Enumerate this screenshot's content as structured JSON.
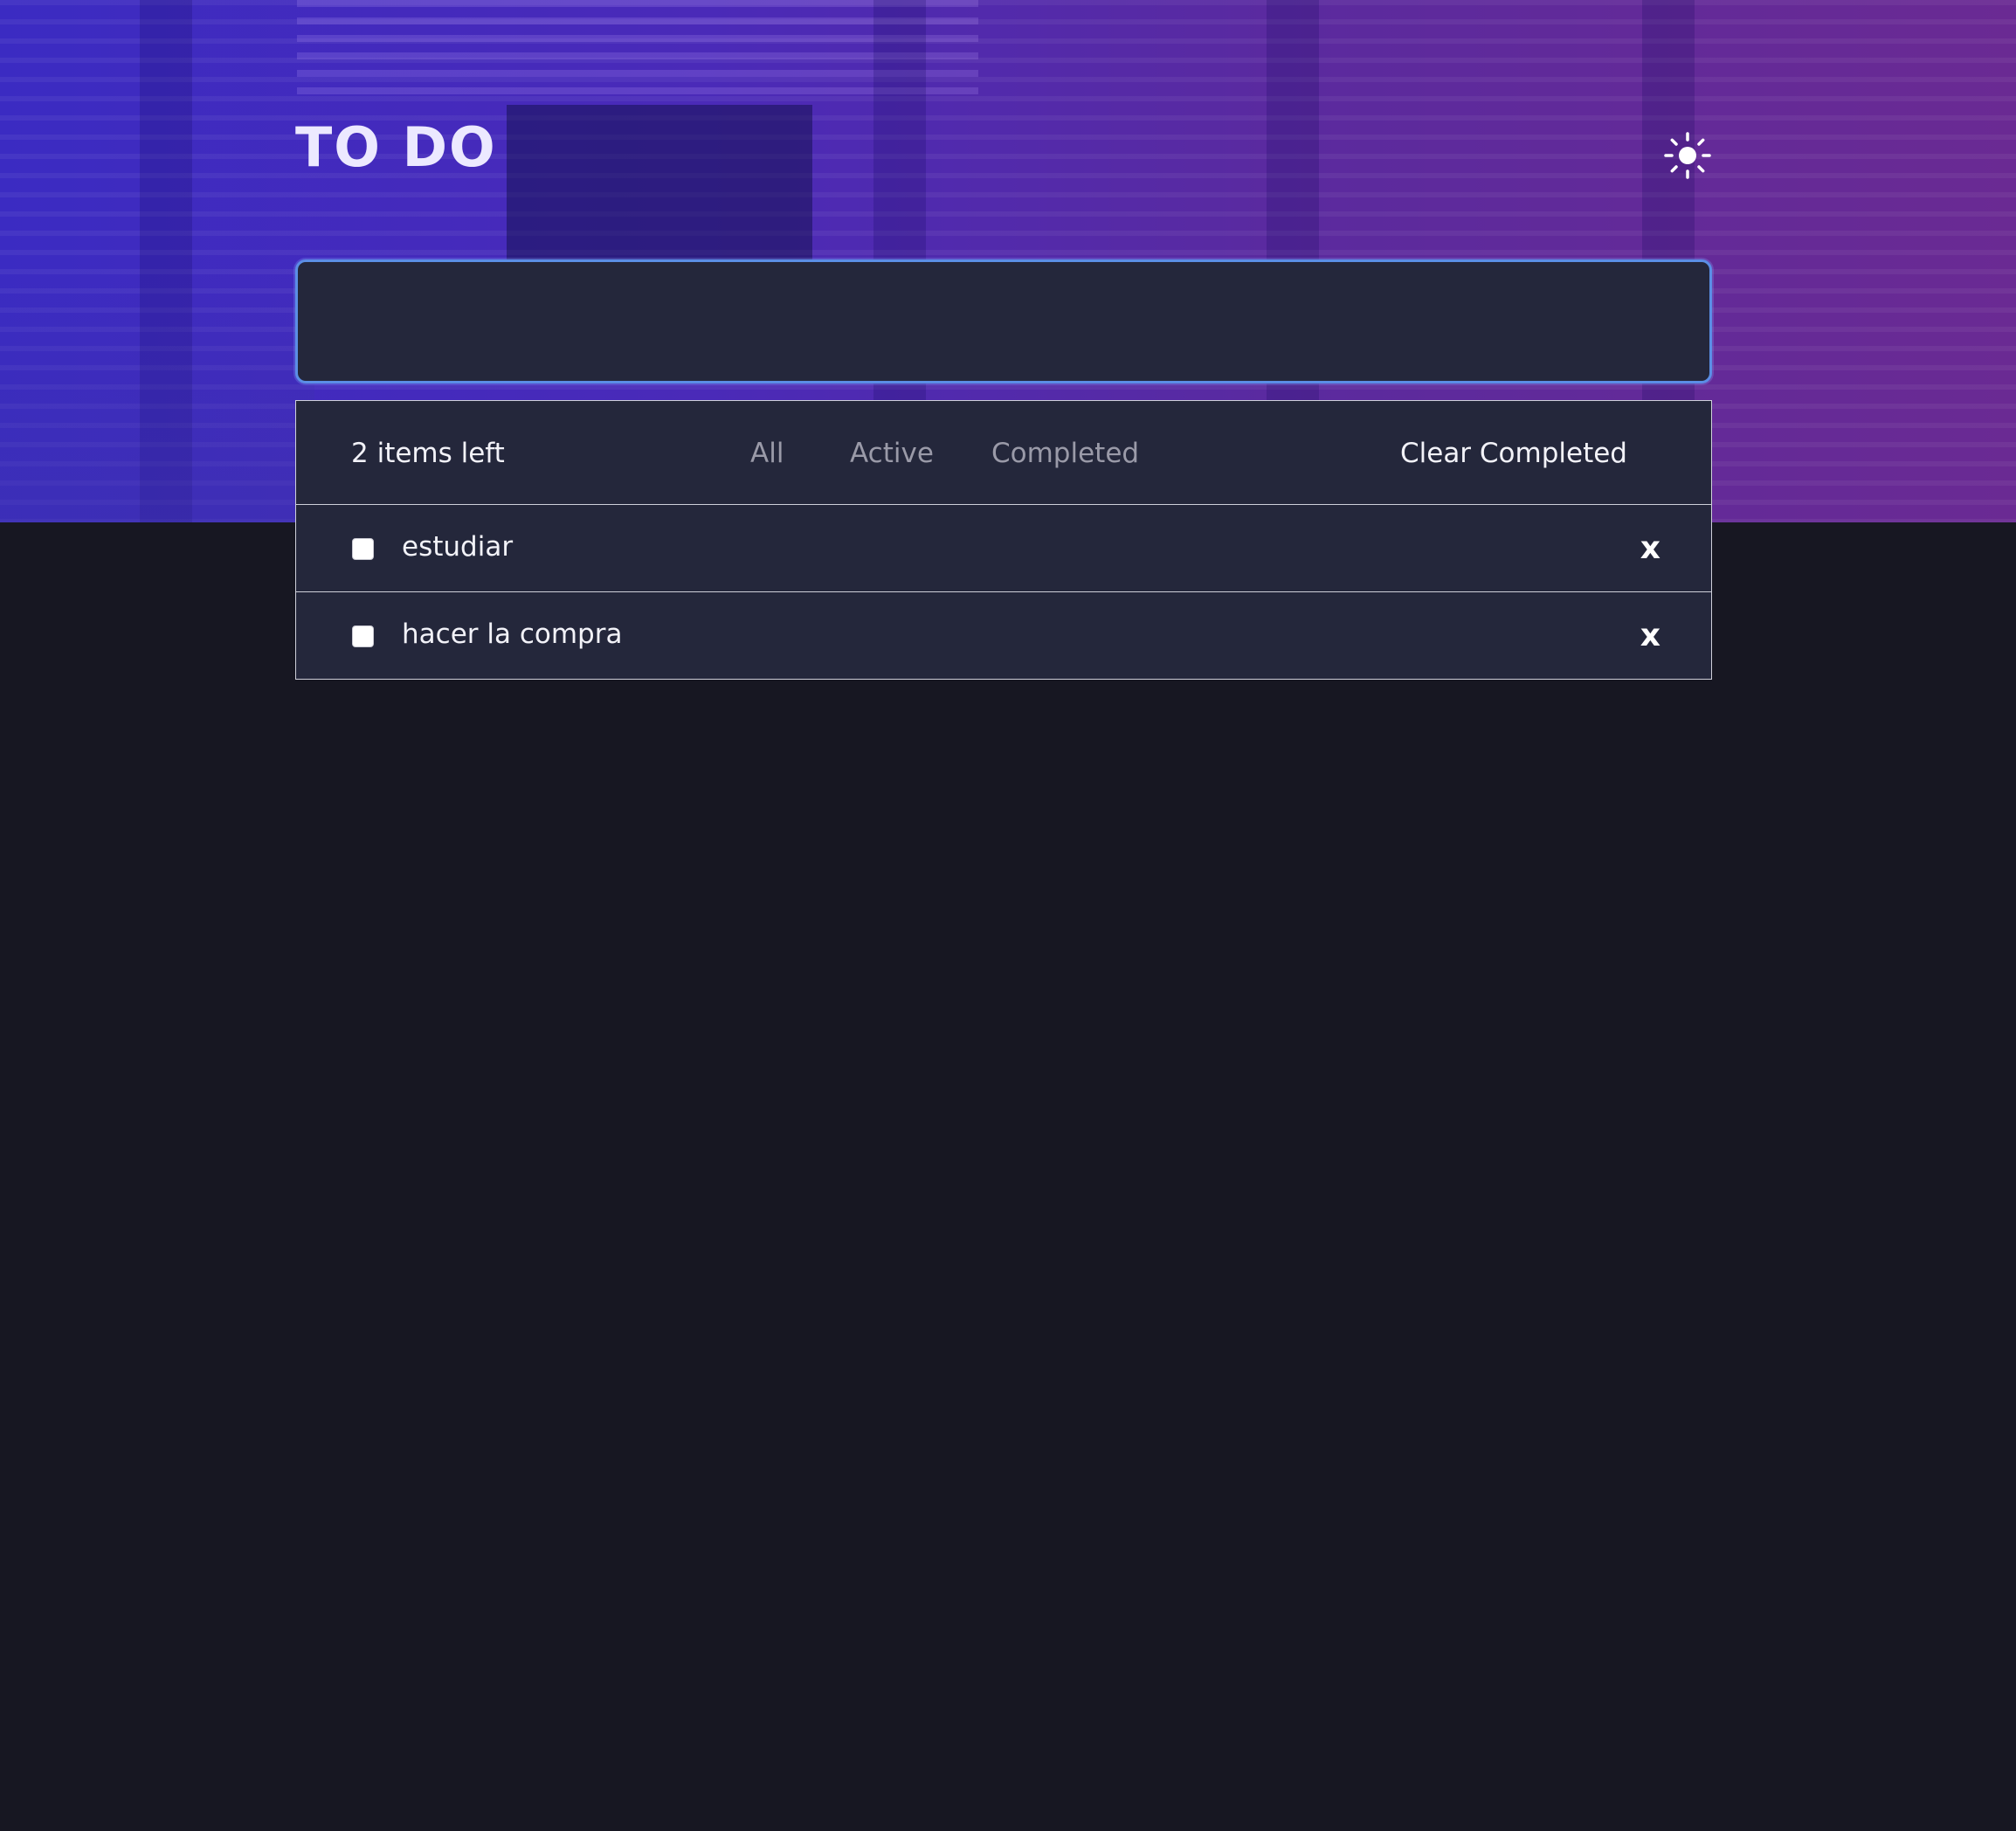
{
  "header": {
    "title": "TO DO",
    "theme_icon": "sun-icon"
  },
  "new_todo": {
    "value": "",
    "placeholder": ""
  },
  "footer": {
    "items_left": "2 items left",
    "filters": [
      "All",
      "Active",
      "Completed"
    ],
    "clear_label": "Clear Completed"
  },
  "todos": [
    {
      "text": "estudiar",
      "completed": false,
      "delete_label": "x"
    },
    {
      "text": "hacer la compra",
      "completed": false,
      "delete_label": "x"
    }
  ],
  "colors": {
    "background": "#171722",
    "panel": "#24273b",
    "input_focus_border": "#5b8ee6",
    "hero_gradient_start": "#3b2bc2",
    "hero_gradient_end": "#6a2a93"
  }
}
